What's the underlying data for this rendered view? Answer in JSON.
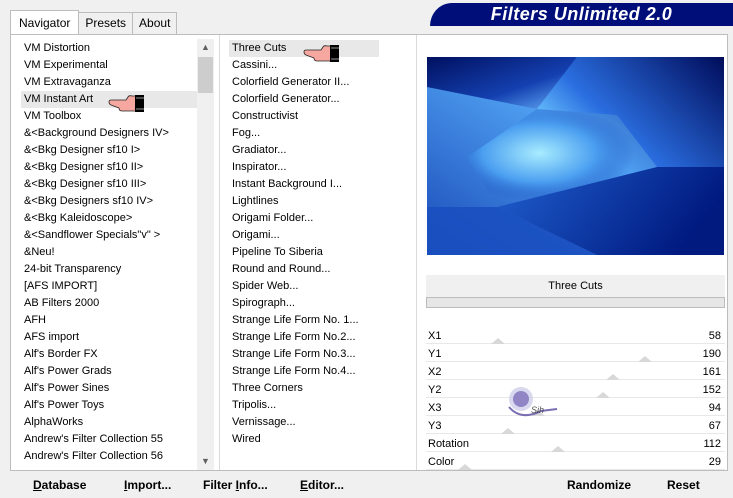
{
  "tabs": [
    {
      "label": "Navigator",
      "active": true
    },
    {
      "label": "Presets",
      "active": false
    },
    {
      "label": "About",
      "active": false
    }
  ],
  "banner": {
    "title": "Filters Unlimited 2.0"
  },
  "categories": [
    "VM Distortion",
    "VM Experimental",
    "VM Extravaganza",
    "VM Instant Art",
    "VM Toolbox",
    "&<Background Designers IV>",
    "&<Bkg Designer sf10 I>",
    "&<Bkg Designer sf10 II>",
    "&<Bkg Designer sf10 III>",
    "&<Bkg Designers sf10 IV>",
    "&<Bkg Kaleidoscope>",
    "&<Sandflower Specials\"v\" >",
    "&Neu!",
    "24-bit Transparency",
    "[AFS IMPORT]",
    "AB Filters 2000",
    "AFH",
    "AFS import",
    "Alf's Border FX",
    "Alf's Power Grads",
    "Alf's Power Sines",
    "Alf's Power Toys",
    "AlphaWorks",
    "Andrew's Filter Collection 55",
    "Andrew's Filter Collection 56"
  ],
  "selected_category": "VM Instant Art",
  "filters": [
    "Three Cuts",
    "Cassini...",
    "Colorfield Generator II...",
    "Colorfield Generator...",
    "Constructivist",
    "Fog...",
    "Gradiator...",
    "Inspirator...",
    "Instant Background I...",
    "Lightlines",
    "Origami Folder...",
    "Origami...",
    "Pipeline To Siberia",
    "Round and Round...",
    "Spider Web...",
    "Spirograph...",
    "Strange Life Form No. 1...",
    "Strange Life Form No.2...",
    "Strange Life Form No.3...",
    "Strange Life Form No.4...",
    "Three Corners",
    "Tripolis...",
    "Vernissage...",
    "Wired"
  ],
  "selected_filter": "Three Cuts",
  "filter_name": "Three Cuts",
  "params": [
    {
      "label": "X1",
      "value": 58,
      "max": 255
    },
    {
      "label": "Y1",
      "value": 190,
      "max": 255
    },
    {
      "label": "X2",
      "value": 161,
      "max": 255
    },
    {
      "label": "Y2",
      "value": 152,
      "max": 255
    },
    {
      "label": "X3",
      "value": 94,
      "max": 255
    },
    {
      "label": "Y3",
      "value": 67,
      "max": 255
    },
    {
      "label": "Rotation",
      "value": 112,
      "max": 255
    },
    {
      "label": "Color",
      "value": 29,
      "max": 255
    }
  ],
  "buttons": {
    "database": {
      "label": "Database",
      "u": "D",
      "rest": "atabase"
    },
    "import": {
      "label": "Import...",
      "u": "I",
      "rest": "mport..."
    },
    "filter_info": {
      "label": "Filter Info...",
      "pre": "Filter ",
      "u": "I",
      "rest": "nfo..."
    },
    "editor": {
      "label": "Editor...",
      "u": "E",
      "rest": "ditor..."
    },
    "randomize": {
      "label": "Randomize"
    },
    "reset": {
      "label": "Reset"
    }
  },
  "colors": {
    "banner": "#000e7a",
    "preview_dark": "#001060",
    "preview_light": "#8ed8ff"
  }
}
